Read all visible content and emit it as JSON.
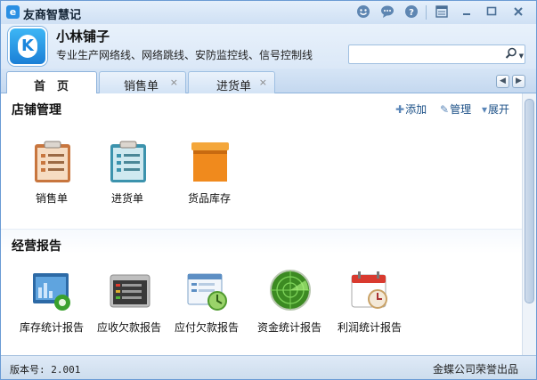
{
  "window": {
    "title": "友商智慧记",
    "app_icon_glyph": "e"
  },
  "titlebar": {
    "buttons": [
      "smile-icon",
      "chat-icon",
      "help-icon",
      "skin-icon",
      "minimize-icon",
      "maximize-icon",
      "close-icon"
    ]
  },
  "header": {
    "logo_letter": "K",
    "shop_name": "小林铺子",
    "shop_desc": "专业生产网络线、网络跳线、安防监控线、信号控制线",
    "search_placeholder": "",
    "search_icon": "⚲"
  },
  "tabs": [
    {
      "label": "首　页",
      "active": true,
      "closable": false
    },
    {
      "label": "销售单",
      "active": false,
      "closable": true,
      "close": "×"
    },
    {
      "label": "进货单",
      "active": false,
      "closable": true,
      "close": "×"
    }
  ],
  "nav": {
    "prev": "◀",
    "next": "▶"
  },
  "store_section": {
    "title": "店铺管理",
    "actions": [
      {
        "icon": "✚",
        "label": "添加"
      },
      {
        "icon": "✎",
        "label": "管理"
      },
      {
        "icon": "▾",
        "label": "展开"
      }
    ],
    "items": [
      {
        "label": "销售单",
        "icon": "sales-clipboard-icon"
      },
      {
        "label": "进货单",
        "icon": "purchase-clipboard-icon"
      },
      {
        "label": "货品库存",
        "icon": "inventory-box-icon"
      }
    ]
  },
  "report_section": {
    "title": "经营报告",
    "items": [
      {
        "label": "库存统计报告",
        "icon": "inventory-report-icon"
      },
      {
        "label": "应收欠款报告",
        "icon": "receivable-report-icon"
      },
      {
        "label": "应付欠款报告",
        "icon": "payable-report-icon"
      },
      {
        "label": "资金统计报告",
        "icon": "fund-radar-icon"
      },
      {
        "label": "利润统计报告",
        "icon": "profit-calendar-icon"
      }
    ]
  },
  "status": {
    "version": "版本号: 2.001",
    "credit": "金蝶公司荣誉出品"
  },
  "colors": {
    "accent": "#1b86dc",
    "frame": "#6a9bd4"
  }
}
